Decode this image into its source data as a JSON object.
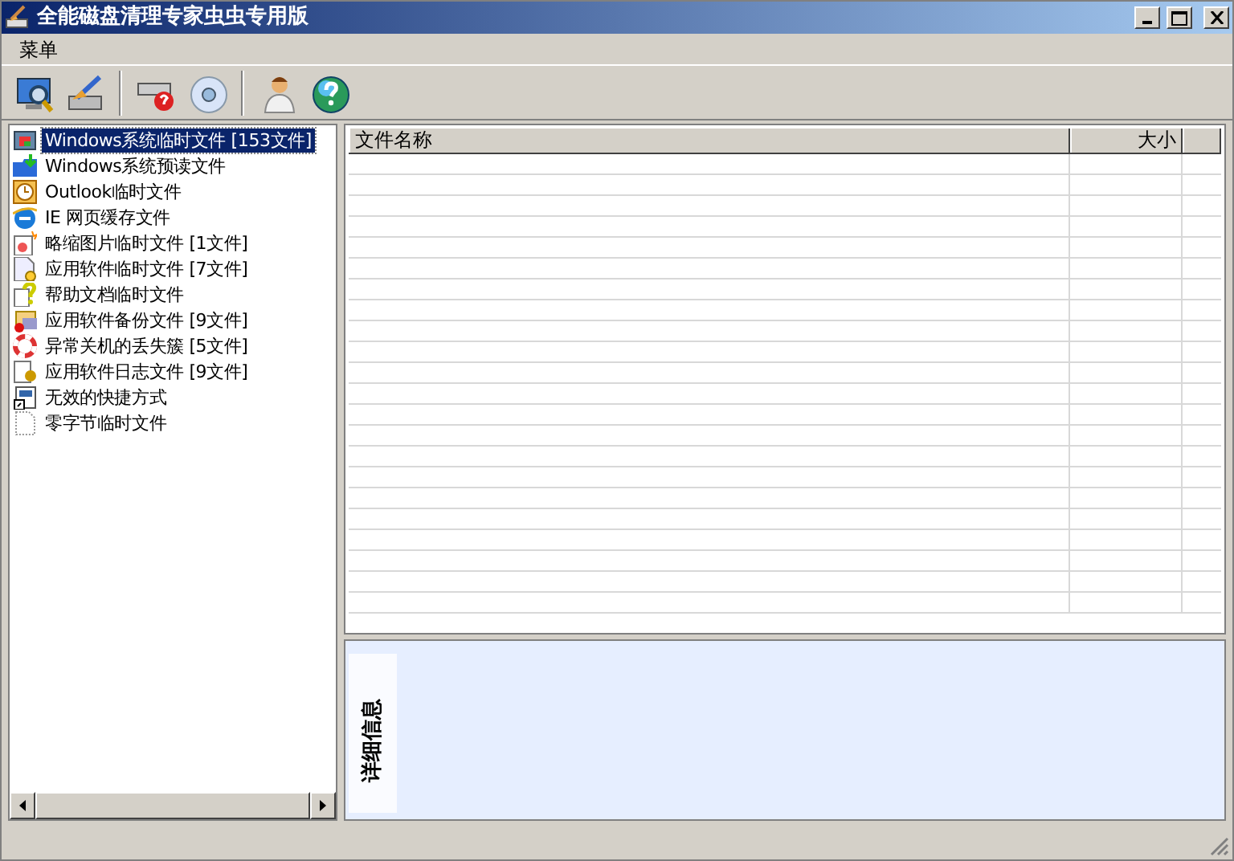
{
  "window": {
    "title": "全能磁盘清理专家虫虫专用版"
  },
  "menu": [
    "菜单"
  ],
  "tree": [
    {
      "label": "Windows系统临时文件 [153文件]",
      "selected": true
    },
    {
      "label": "Windows系统预读文件",
      "selected": false
    },
    {
      "label": "Outlook临时文件",
      "selected": false
    },
    {
      "label": "IE 网页缓存文件",
      "selected": false
    },
    {
      "label": "略缩图片临时文件 [1文件]",
      "selected": false
    },
    {
      "label": "应用软件临时文件 [7文件]",
      "selected": false
    },
    {
      "label": "帮助文档临时文件",
      "selected": false
    },
    {
      "label": "应用软件备份文件 [9文件]",
      "selected": false
    },
    {
      "label": "异常关机的丢失簇 [5文件]",
      "selected": false
    },
    {
      "label": "应用软件日志文件 [9文件]",
      "selected": false
    },
    {
      "label": "无效的快捷方式",
      "selected": false
    },
    {
      "label": "零字节临时文件",
      "selected": false
    }
  ],
  "table": {
    "columns": [
      "文件名称",
      "大小"
    ]
  },
  "details": {
    "label": "详细信息"
  }
}
